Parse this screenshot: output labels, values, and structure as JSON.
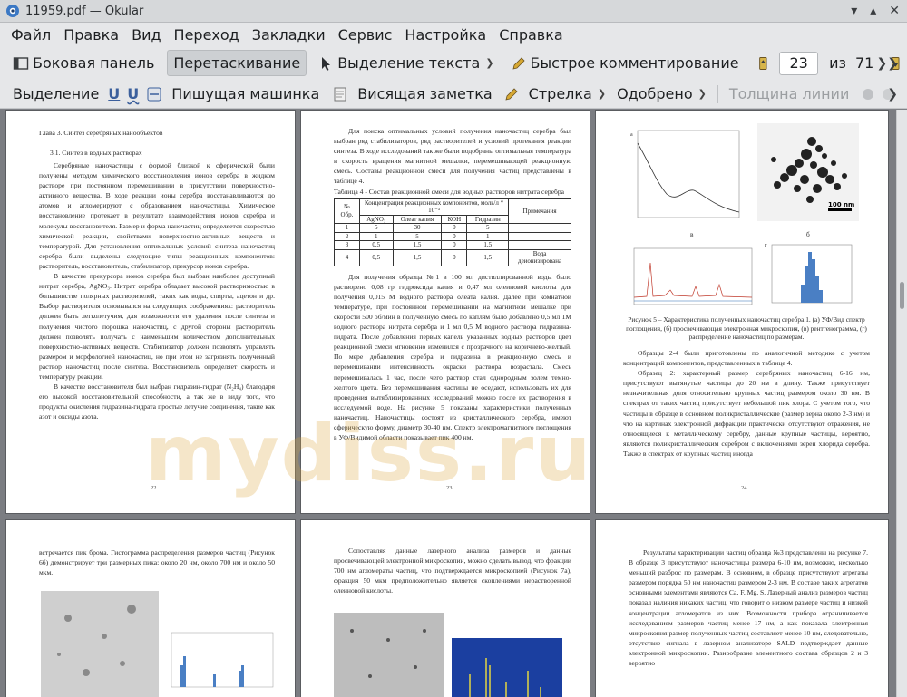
{
  "window": {
    "title": "11959.pdf — Okular"
  },
  "menu": [
    "Файл",
    "Правка",
    "Вид",
    "Переход",
    "Закладки",
    "Сервис",
    "Настройка",
    "Справка"
  ],
  "toolbar1": {
    "sidebar": "Боковая панель",
    "drag": "Перетаскивание",
    "text_select": "Выделение текста",
    "quick_comment": "Быстрое комментирование",
    "page_current": "23",
    "page_of": "из",
    "page_total": "71"
  },
  "toolbar2": {
    "highlight": "Выделение",
    "typewriter": "Пишущая машинка",
    "sticky_note": "Висящая заметка",
    "arrow": "Стрелка",
    "stamp": "Одобрено",
    "line_width": "Толщина линии"
  },
  "watermark": "mydiss.ru",
  "pages": {
    "p22": {
      "chapter": "Глава 3. Синтез серебряных нанообъектов",
      "section": "3.1. Синтез в водных растворах",
      "paragraphs": [
        "Серебряные наночастицы с формой близкой к сферической были получены методом химического восстановления ионов серебра в жидком растворе при постоянном перемешивании в присутствии поверхностно-активного вещества. В ходе реакции ионы серебра восстанавливаются до атомов и агломерируют с образованием наночастицы. Химическое восстановление протекает в результате взаимодействия ионов серебра и молекулы восстановителя. Размер и форма наночастиц определяется скоростью химической реакции, свойствами поверхностно-активных веществ и температурой. Для установления оптимальных условий синтеза наночастиц серебра были выделены следующие типы реакционных компонентов: растворитель, восстановитель, стабилизатор, прекурсор ионов серебра.",
        "В качестве прекурсора ионов серебра был выбран наиболее доступный нитрат серебра, AgNO₃. Нитрат серебра обладает высокой растворимостью в большинстве полярных растворителей, таких как воды, спирты, ацетон и др. Выбор растворителя основывался на следующих соображениях: растворитель должен быть легколетучим, для возможности его удаления после синтеза и получения чистого порошка наночастиц, с другой стороны растворитель должен позволять получать с наименьшим количеством дополнительных поверхностно-активных веществ. Стабилизатор должен позволять управлять размером и морфологией наночастиц, но при этом не загрязнять полученный раствор наночастиц после синтеза. Восстановитель определяет скорость и температуру реакции.",
        "В качестве восстановителя был выбран гидразин-гидрат (N₂H₄) благодаря его высокой восстановительной способности, а так же в виду того, что продукты окисления гидразина-гидрата простые летучие соединения, такие как азот и оксиды азота."
      ],
      "num": "22"
    },
    "p23": {
      "intro": "Для поиска оптимальных условий получения наночастиц серебра был выбран ряд стабилизаторов, ряд растворителей и условий протекания реакции синтеза. В ходе исследований так же были подобраны оптимальная температура и скорость вращения магнитной мешалки, перемешивающей реакционную смесь. Составы реакционной смеси для получения частиц представлены в таблице 4.",
      "table_title": "Таблица 4 - Состав реакционной смеси для водных растворов нитрата серебра",
      "table_head": [
        "№ Обр.",
        "Концентрация реакционных компонентов, моль/л * 10⁻³",
        "Примечания"
      ],
      "table_sub": [
        "AgNO₃",
        "Олеат калия",
        "КОН",
        "Гидразин"
      ],
      "table_rows": [
        [
          "1",
          "5",
          "30",
          "0",
          "5",
          ""
        ],
        [
          "2",
          "1",
          "5",
          "0",
          "1",
          ""
        ],
        [
          "3",
          "0,5",
          "1,5",
          "0",
          "1,5",
          ""
        ],
        [
          "4",
          "0,5",
          "1,5",
          "0",
          "1,5",
          "Вода деионизирована"
        ]
      ],
      "body": "Для получения образца №1 в 100 мл дистиллированной воды было растворено 0,08 гр гидроксида калия и 0,47 мл олеиновой кислоты для получения 0,015 М водного раствора олеата калия. Далее при комнатной температуре, при постоянном перемешивании на магнитной мешалке при скорости 500 об/мин в полученную смесь по каплям было добавлено 0,5 мл 1М водного раствора нитрата серебра и 1 мл 0,5 М водного раствора гидразина-гидрата. После добавления первых капель указанных водных растворов цвет реакционной смеси мгновенно изменился с прозрачного на коричнево-желтый. По мере добавления серебра и гидразина в реакционную смесь и перемешивании интенсивность окраски раствора возрастала. Смесь перемешивалась 1 час, после чего раствор стал однородным золем темно-желтого цвета. Без перемешивания частицы не оседают, использовать их для проведения вытяблизированных исследований можно после их растворения в исследуемой воде. На рисунке 5 показаны характеристики полученных наночастиц. Наночастицы состоят из кристаллического серебра, имеют сферическую форму, диаметр 30-40 нм. Спектр электромагнитного поглощения в УФ/Видимой области показывает пик 400 нм.",
      "num": "23"
    },
    "p24": {
      "fig_labels": [
        "а",
        "б",
        "в",
        "г"
      ],
      "scale": "100 nm",
      "caption": "Рисунок 5 – Характеристика полученных наночастиц серебра 1. (а) УФ/Вид спектр поглощения, (б) просвечивающая электронная микроскопия, (в) рентгенограмма, (г) распределение наночастиц по размерам.",
      "body1": "Образцы 2-4 были приготовлены по аналогичной методике с учетом концентраций компонентов, представленных в таблице 4.",
      "body2": "Образец 2: характерный размер серебряных наночастиц 6-16 нм, присутствуют вытянутые частицы до 20 нм в длину. Также присутствует незначительная доля относительно крупных частиц размером около 30 нм. В спектрах от таких частиц присутствует небольшой пик хлора. С учетом того, что частицы в образце в основном поликристаллические (размер зерна около 2-3 нм) и что на картинах электронной дифракции практически отсутствуют отражения, не относящиеся к металлическому серебру, данные крупные частицы, вероятно, являются поликристаллическим серебром с включениями зерен хлорида серебра. Также в спектрах от крупных частиц иногда",
      "num": "24"
    },
    "p25": {
      "body": "встречается пик брома. Гистограмма распределения размеров частиц (Рисунок 6б) демонстрирует три размерных пика: около 20 нм, около 700 нм и около 50 мкм."
    },
    "p26": {
      "body": "Сопоставляя данные лазерного анализа размеров и данные просвечивающей электронной микроскопии, можно сделать вывод, что фракции 700 нм агломераты частиц, что подтверждается микроскопией (Рисунок 7а), фракция 50 мкм предположительно является скоплениями нерастворенной олеиновой кислоты."
    },
    "p27": {
      "body": "Результаты характеризации частиц образца №3 представлены на рисунке 7. В образце 3 присутствуют наночастицы размера 6-10 нм, возможно, несколько меньший разброс по размерам. В основном, в образце присутствуют агрегаты размером порядка 50 нм наночастиц размером 2-3 нм. В составе таких агрегатов основными элементами являются Ca, F, Mg, S. Лазерный анализ размеров частиц показал наличия никаких частиц, что говорит о низком размере частиц и низкой концентрации агломератов из них. Возможности прибора ограничивается исследованием размеров частиц менее 17 нм, а как показала электронная микроскопия размер полученных частиц составляет менее 10 нм, следовательно, отсутствие сигнала в лазерном анализаторе SALD подтверждает данные электронной микроскопии. Разнообразие элементного состава образцов 2 и 3 вероятно"
    }
  }
}
